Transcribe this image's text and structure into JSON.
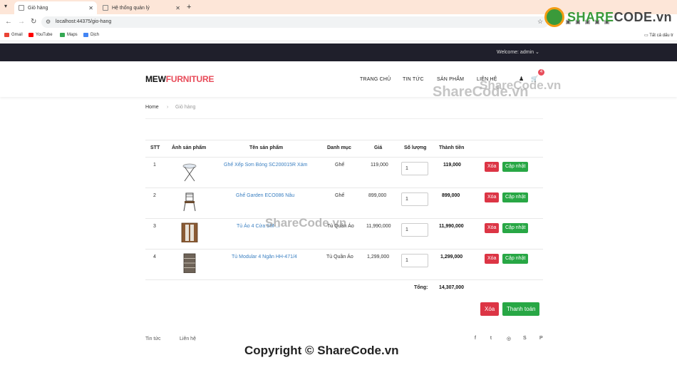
{
  "browser": {
    "tabs": [
      {
        "label": "Giỏ hàng",
        "active": true
      },
      {
        "label": "Hệ thống quản lý",
        "active": false
      }
    ],
    "url": "localhost:44375/gio-hang",
    "bookmarks": [
      "Gmail",
      "YouTube",
      "Maps",
      "Dịch"
    ],
    "all_bookmarks": "Tất cả dấu tr"
  },
  "watermark": {
    "logo_main": "SHARE",
    "logo_suffix": "CODE.vn",
    "header_overlay": "ShareCode.vn",
    "header_overlay2": "ShareCode.vn",
    "row_overlay": "ShareCode.vn",
    "copyright": "Copyright © ShareCode.vn"
  },
  "topbar": {
    "welcome": "Welcome: admin"
  },
  "header": {
    "brand_dark": "MEW",
    "brand_accent": "FURNITURE",
    "menu": [
      "TRANG CHỦ",
      "TIN TỨC",
      "SẢN PHẨM",
      "LIÊN HỆ"
    ],
    "cart_count": "4"
  },
  "breadcrumb": {
    "home": "Home",
    "current": "Giỏ hàng"
  },
  "table": {
    "headers": [
      "STT",
      "Ảnh sản phẩm",
      "Tên sản phẩm",
      "Danh mục",
      "Giá",
      "Số lượng",
      "Thành tiền"
    ],
    "rows": [
      {
        "stt": "1",
        "name": "Ghế Xếp Sơn Bóng SC200015R Xám",
        "category": "Ghế",
        "price": "119,000",
        "qty": "1",
        "total": "119,000"
      },
      {
        "stt": "2",
        "name": "Ghế Garden ECO086 Nâu",
        "category": "Ghế",
        "price": "899,000",
        "qty": "1",
        "total": "899,000"
      },
      {
        "stt": "3",
        "name": "Tủ Áo 4 Cửa SM-...",
        "category": "Tủ Quần Áo",
        "price": "11,990,000",
        "qty": "1",
        "total": "11,990,000"
      },
      {
        "stt": "4",
        "name": "Tủ Modular 4 Ngăn HH-471/4",
        "category": "Tủ Quần Áo",
        "price": "1,299,000",
        "qty": "1",
        "total": "1,299,000"
      }
    ],
    "delete_label": "Xóa",
    "update_label": "Cập nhật",
    "total_label": "Tổng:",
    "total_value": "14,307,000"
  },
  "actions": {
    "clear_label": "Xóa",
    "pay_label": "Thanh toán"
  },
  "footer": {
    "links": [
      "Tin tức",
      "Liên hệ"
    ],
    "social": [
      "f",
      "t",
      "◎",
      "S",
      "P"
    ]
  },
  "colors": {
    "accent": "#e84c5a",
    "danger": "#dc3545",
    "success": "#28a745",
    "topbar": "#1f1f2b"
  }
}
